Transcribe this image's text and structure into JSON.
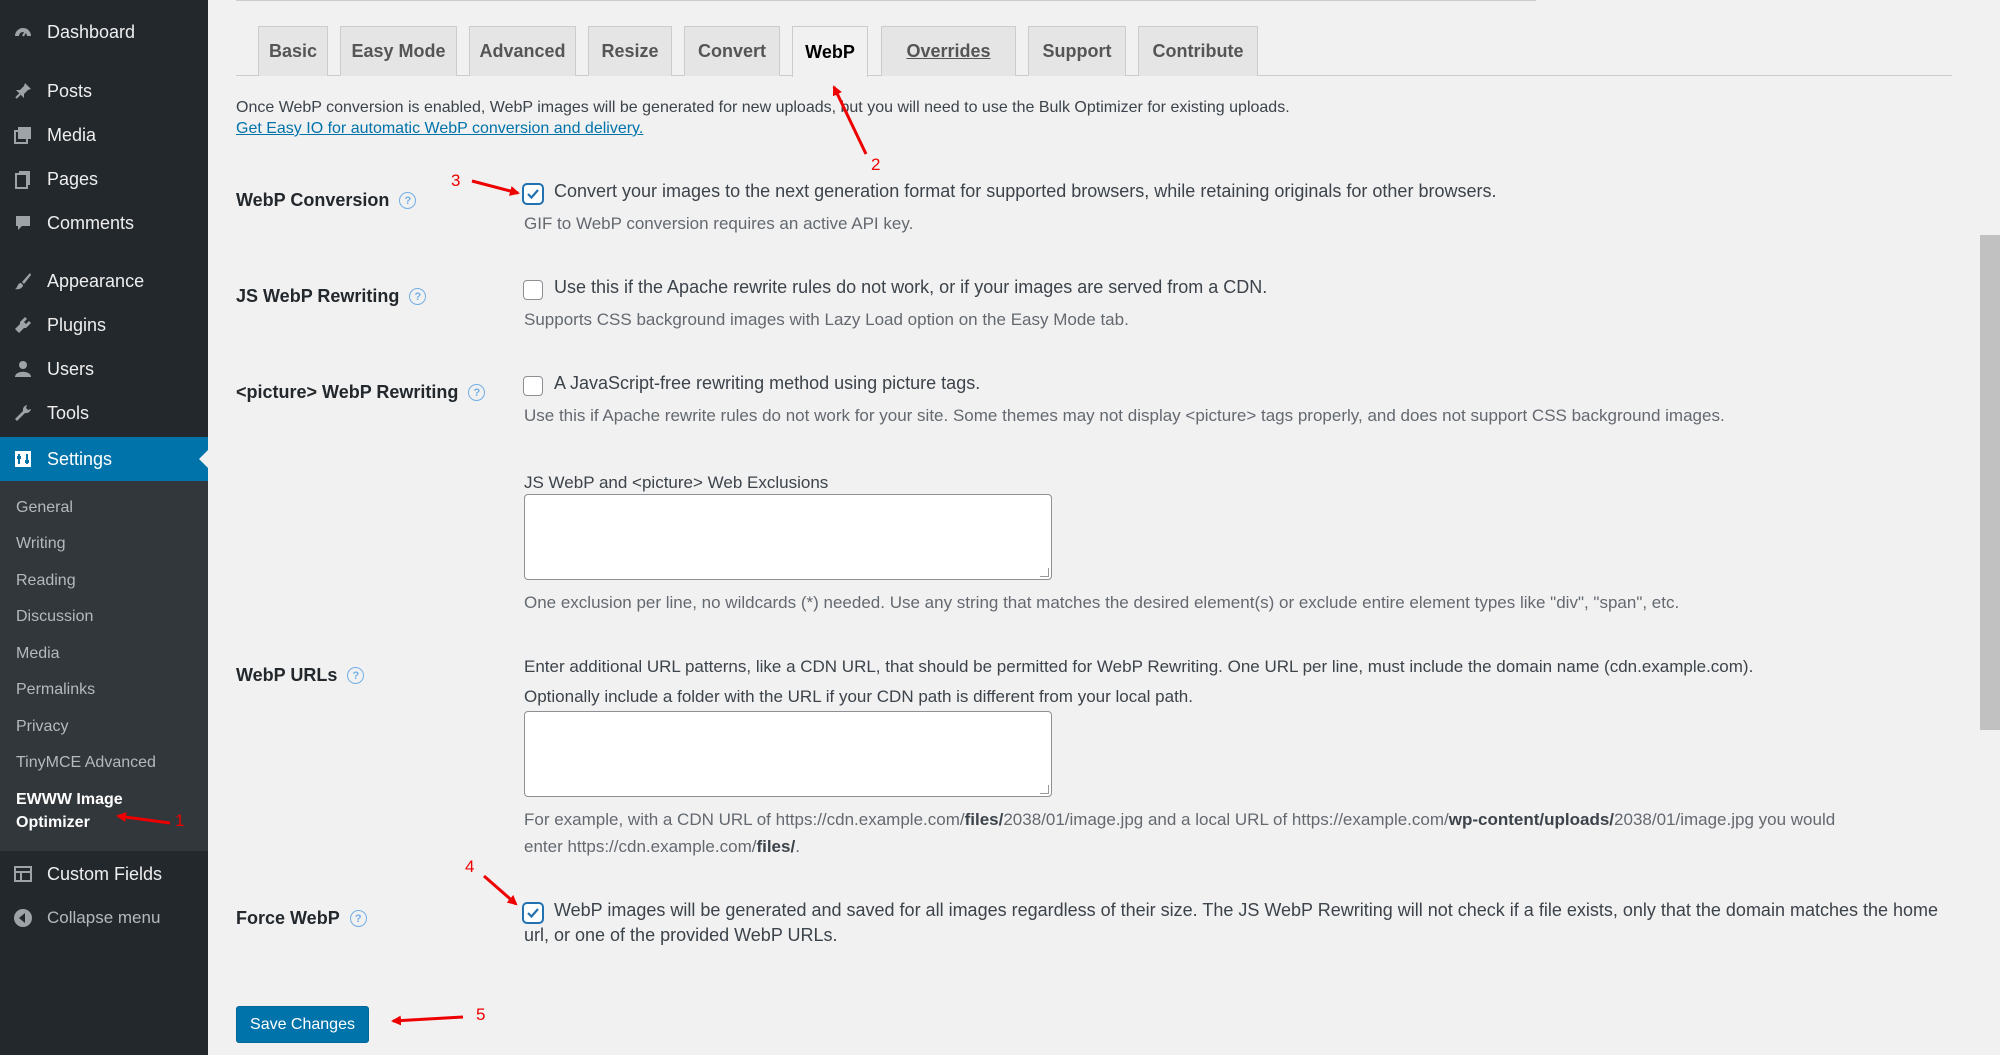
{
  "sidebar": {
    "items": [
      {
        "label": "Dashboard",
        "icon": "dashboard-icon"
      },
      {
        "label": "Posts",
        "icon": "pin-icon"
      },
      {
        "label": "Media",
        "icon": "media-icon"
      },
      {
        "label": "Pages",
        "icon": "pages-icon"
      },
      {
        "label": "Comments",
        "icon": "comment-icon"
      },
      {
        "label": "Appearance",
        "icon": "brush-icon"
      },
      {
        "label": "Plugins",
        "icon": "plugin-icon"
      },
      {
        "label": "Users",
        "icon": "user-icon"
      },
      {
        "label": "Tools",
        "icon": "wrench-icon"
      },
      {
        "label": "Settings",
        "icon": "settings-icon"
      }
    ],
    "submenu": [
      "General",
      "Writing",
      "Reading",
      "Discussion",
      "Media",
      "Permalinks",
      "Privacy",
      "TinyMCE Advanced"
    ],
    "current_sub_line1": "EWWW Image",
    "current_sub_line2": "Optimizer",
    "custom_fields": "Custom Fields",
    "collapse": "Collapse menu"
  },
  "tabs": [
    "Basic",
    "Easy Mode",
    "Advanced",
    "Resize",
    "Convert",
    "WebP",
    "Overrides",
    "Support",
    "Contribute"
  ],
  "active_tab": "WebP",
  "intro": "Once WebP conversion is enabled, WebP images will be generated for new uploads, but you will need to use the Bulk Optimizer for existing uploads.",
  "intro_link": "Get Easy IO for automatic WebP conversion and delivery.",
  "settings": {
    "webp_conversion": {
      "label": "WebP Conversion",
      "checked": true,
      "text": "Convert your images to the next generation format for supported browsers, while retaining originals for other browsers.",
      "desc": "GIF to WebP conversion requires an active API key."
    },
    "js_rewriting": {
      "label": "JS WebP Rewriting",
      "checked": false,
      "text": "Use this if the Apache rewrite rules do not work, or if your images are served from a CDN.",
      "desc": "Supports CSS background images with Lazy Load option on the Easy Mode tab."
    },
    "picture_rewriting": {
      "label": "<picture> WebP Rewriting",
      "checked": false,
      "text": "A JavaScript-free rewriting method using picture tags.",
      "desc": "Use this if Apache rewrite rules do not work for your site. Some themes may not display <picture> tags properly, and does not support CSS background images."
    },
    "exclusions": {
      "label": "JS WebP and <picture> Web Exclusions",
      "value": "",
      "desc": "One exclusion per line, no wildcards (*) needed. Use any string that matches the desired element(s) or exclude entire element types like \"div\", \"span\", etc."
    },
    "webp_urls": {
      "label": "WebP URLs",
      "text1": "Enter additional URL patterns, like a CDN URL, that should be permitted for WebP Rewriting. One URL per line, must include the domain name (cdn.example.com).",
      "text2": "Optionally include a folder with the URL if your CDN path is different from your local path.",
      "value": "",
      "ex_a": "For example, with a CDN URL of https://cdn.example.com/",
      "ex_b": "files/",
      "ex_c": "2038/01/image.jpg and a local URL of https://example.com/",
      "ex_d": "wp-content/uploads/",
      "ex_e": "2038/01/image.jpg you would",
      "ex_f": "enter https://cdn.example.com/",
      "ex_g": "files/",
      "ex_h": "."
    },
    "force_webp": {
      "label": "Force WebP",
      "checked": true,
      "text1": "WebP images will be generated and saved for all images regardless of their size. The JS WebP Rewriting will not check if a file exists, only that the domain matches the home",
      "text2": "url, or one of the provided WebP URLs."
    }
  },
  "save_button": "Save Changes",
  "annotations": [
    "1",
    "2",
    "3",
    "4",
    "5"
  ],
  "colors": {
    "accent": "#0073aa",
    "sidebar": "#23282d",
    "annotation": "#e00000"
  }
}
